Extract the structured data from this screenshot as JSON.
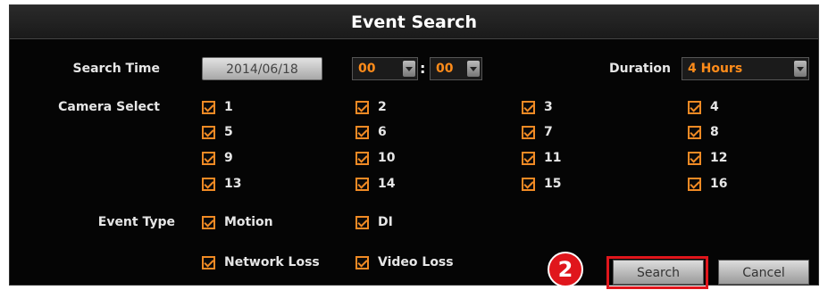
{
  "title": "Event Search",
  "search_time": {
    "label": "Search Time",
    "date": "2014/06/18",
    "hour": "00",
    "colon": ":",
    "minute": "00"
  },
  "duration": {
    "label": "Duration",
    "value": "4 Hours"
  },
  "camera_select": {
    "label": "Camera Select",
    "cameras": [
      "1",
      "2",
      "3",
      "4",
      "5",
      "6",
      "7",
      "8",
      "9",
      "10",
      "11",
      "12",
      "13",
      "14",
      "15",
      "16"
    ]
  },
  "event_type": {
    "label": "Event Type",
    "options": [
      "Motion",
      "DI",
      "Network Loss",
      "Video Loss"
    ]
  },
  "buttons": {
    "search": "Search",
    "cancel": "Cancel"
  },
  "annotation": {
    "step": "2"
  },
  "colors": {
    "accent": "#f08a24",
    "highlight": "#e0161c"
  }
}
